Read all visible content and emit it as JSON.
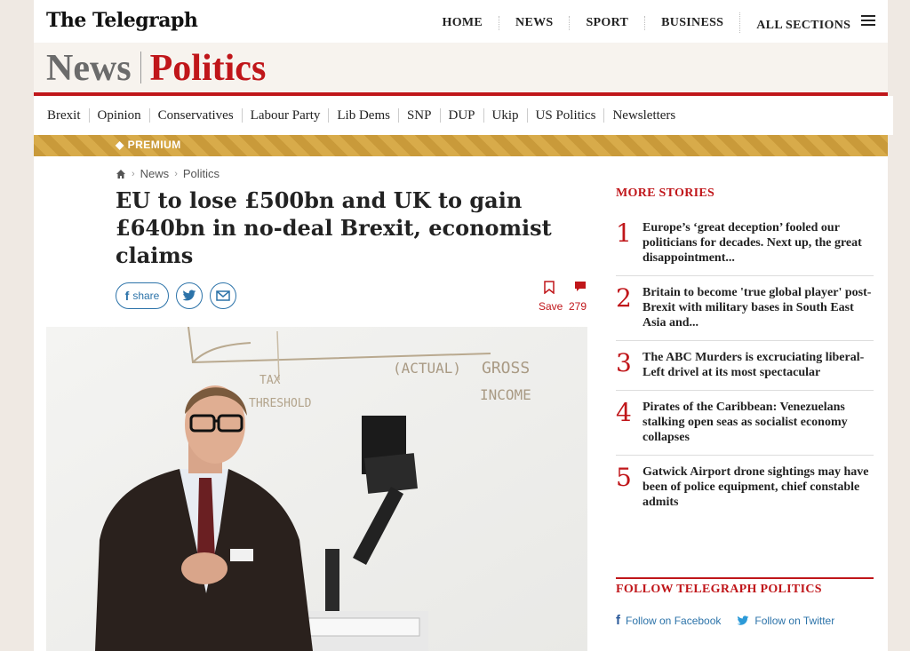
{
  "masthead": {
    "logo": "The Telegraph"
  },
  "topnav": [
    "HOME",
    "NEWS",
    "SPORT",
    "BUSINESS",
    "ALL SECTIONS"
  ],
  "section": {
    "parent": "News",
    "current": "Politics"
  },
  "subnav": [
    "Brexit",
    "Opinion",
    "Conservatives",
    "Labour Party",
    "Lib Dems",
    "SNP",
    "DUP",
    "Ukip",
    "US Politics",
    "Newsletters"
  ],
  "premium": {
    "label": "PREMIUM"
  },
  "breadcrumb": {
    "items": [
      "News",
      "Politics"
    ]
  },
  "article": {
    "headline": "EU to lose £500bn and UK to gain £640bn in no-deal Brexit, economist claims",
    "share_label": "share",
    "save_label": "Save",
    "comment_count": "279"
  },
  "photo": {
    "board_words": [
      "(ACTUAL)",
      "GROSS",
      "INCOME",
      "TAX",
      "THRESHOLD"
    ]
  },
  "rail": {
    "more_title": "MORE STORIES",
    "stories": [
      {
        "num": "1",
        "title": "Europe’s ‘great deception’ fooled our politicians for decades. Next up, the great disappointment..."
      },
      {
        "num": "2",
        "title": "Britain to become 'true global player' post-Brexit with military bases in South East Asia and..."
      },
      {
        "num": "3",
        "title": "The ABC Murders is excruciating liberal-Left drivel at its most spectacular"
      },
      {
        "num": "4",
        "title": "Pirates of the Caribbean: Venezuelans stalking open seas as socialist economy collapses"
      },
      {
        "num": "5",
        "title": "Gatwick Airport drone sightings may have been of police equipment, chief constable admits"
      }
    ],
    "follow_title": "FOLLOW TELEGRAPH POLITICS",
    "follow_facebook": "Follow on Facebook",
    "follow_twitter": "Follow on Twitter"
  },
  "colors": {
    "accent": "#c0161a",
    "link": "#2c73a9",
    "premium": "#c99a3a"
  }
}
